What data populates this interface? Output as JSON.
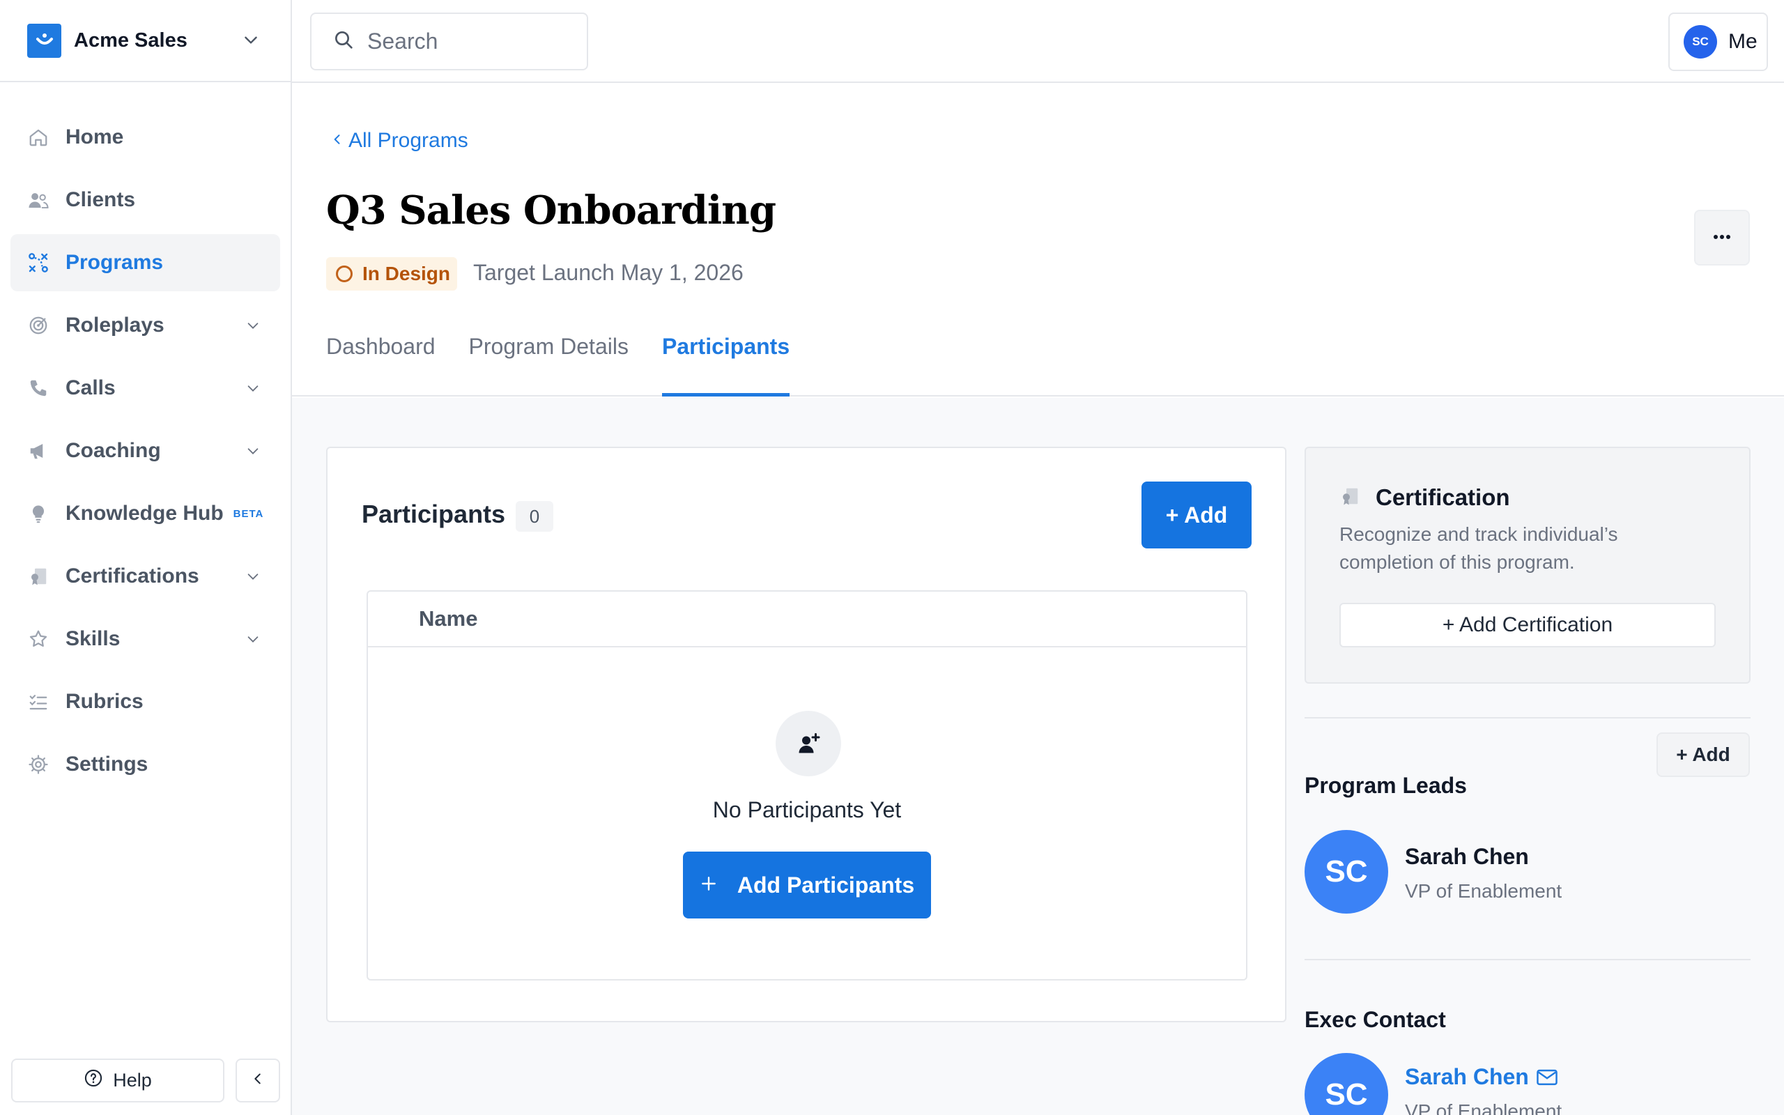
{
  "org": {
    "name": "Acme Sales"
  },
  "search": {
    "placeholder": "Search"
  },
  "user": {
    "initials": "SC",
    "label": "Me"
  },
  "nav": {
    "items": [
      {
        "label": "Home",
        "icon": "home-icon"
      },
      {
        "label": "Clients",
        "icon": "clients-icon"
      },
      {
        "label": "Programs",
        "icon": "programs-icon",
        "active": true
      },
      {
        "label": "Roleplays",
        "icon": "target-icon",
        "expandable": true
      },
      {
        "label": "Calls",
        "icon": "phone-icon",
        "expandable": true
      },
      {
        "label": "Coaching",
        "icon": "megaphone-icon",
        "expandable": true
      },
      {
        "label": "Knowledge Hub",
        "icon": "lightbulb-icon",
        "badge": "BETA"
      },
      {
        "label": "Certifications",
        "icon": "certificate-icon",
        "expandable": true
      },
      {
        "label": "Skills",
        "icon": "star-icon",
        "expandable": true
      },
      {
        "label": "Rubrics",
        "icon": "checklist-icon"
      },
      {
        "label": "Settings",
        "icon": "gear-icon"
      }
    ],
    "help_label": "Help"
  },
  "page": {
    "back_label": "All Programs",
    "title": "Q3 Sales Onboarding",
    "status": "In Design",
    "target_launch": "Target Launch May 1, 2026",
    "tabs": [
      {
        "label": "Dashboard"
      },
      {
        "label": "Program Details"
      },
      {
        "label": "Participants",
        "active": true
      }
    ]
  },
  "participants": {
    "title": "Participants",
    "count": "0",
    "add_label": "+ Add",
    "column_name": "Name",
    "empty_text": "No Participants Yet",
    "add_participants_label": "Add Participants"
  },
  "certification": {
    "title": "Certification",
    "description": "Recognize and track individual’s completion of this program.",
    "button_label": "+ Add Certification"
  },
  "program_leads": {
    "title": "Program Leads",
    "add_label": "+ Add",
    "people": [
      {
        "initials": "SC",
        "name": "Sarah Chen",
        "role": "VP of Enablement"
      }
    ]
  },
  "exec_contact": {
    "title": "Exec Contact",
    "people": [
      {
        "initials": "SC",
        "name": "Sarah Chen",
        "role": "VP of Enablement"
      }
    ]
  },
  "colors": {
    "accent": "#1f7ae0",
    "status_bg": "#fdf3e4",
    "status_text": "#b45309",
    "avatar": "#3b82f6"
  }
}
